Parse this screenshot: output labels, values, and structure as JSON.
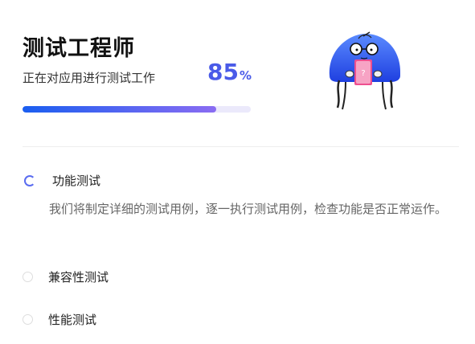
{
  "header": {
    "title": "测试工程师",
    "status_text": "正在对应用进行测试工作",
    "progress_value": "85",
    "progress_unit": "%",
    "progress_fraction": 0.85,
    "bar_start_color": "#1a5ef0",
    "bar_end_color": "#8a6cf2"
  },
  "steps": [
    {
      "label": "功能测试",
      "state": "in-progress",
      "description": "我们将制定详细的测试用例，逐一执行测试用例，检查功能是否正常运作。"
    },
    {
      "label": "兼容性测试",
      "state": "pending"
    },
    {
      "label": "性能测试",
      "state": "pending"
    }
  ],
  "mascot": {
    "badge": "?"
  },
  "colors": {
    "accent": "#4a5be8",
    "mascot_blue": "#2f5bf0",
    "badge_pink": "#ee4f8f"
  }
}
